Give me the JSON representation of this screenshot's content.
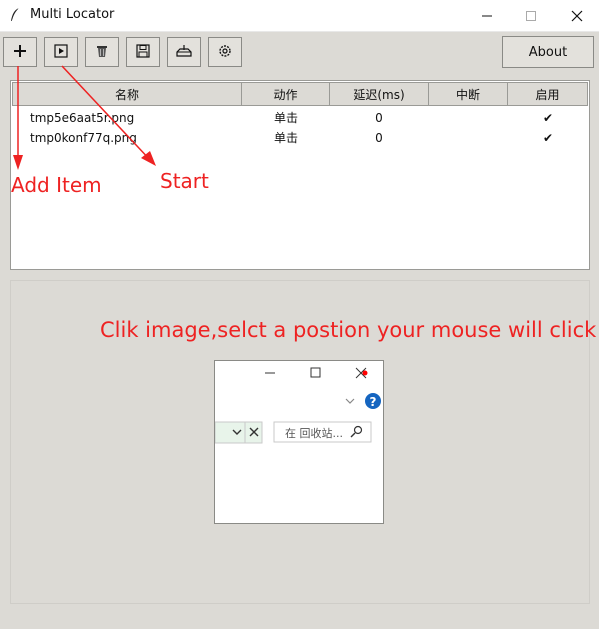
{
  "window": {
    "title": "Multi Locator",
    "icons": {
      "app": "feather-icon",
      "minimize": "minimize-icon",
      "maximize": "maximize-icon",
      "close": "close-icon"
    }
  },
  "toolbar": {
    "buttons": [
      {
        "name": "add-item",
        "icon": "plus-icon"
      },
      {
        "name": "start",
        "icon": "play-icon"
      },
      {
        "name": "delete",
        "icon": "trash-icon"
      },
      {
        "name": "save",
        "icon": "save-icon"
      },
      {
        "name": "load",
        "icon": "tray-icon"
      },
      {
        "name": "settings",
        "icon": "gear-icon"
      }
    ],
    "about_label": "About"
  },
  "table": {
    "columns": [
      "名称",
      "动作",
      "延迟(ms)",
      "中断",
      "启用"
    ],
    "rows": [
      {
        "name": "tmp5e6aat5r.png",
        "action": "单击",
        "delay": "0",
        "interrupt": "",
        "enabled": "✔"
      },
      {
        "name": "tmp0konf77q.png",
        "action": "单击",
        "delay": "0",
        "interrupt": "",
        "enabled": "✔"
      }
    ]
  },
  "annotations": {
    "add_item": "Add Item",
    "start": "Start",
    "hint": "Clik image,selct a postion your mouse will click",
    "color": "#ee2222"
  },
  "preview": {
    "search_placeholder": "在 回收站...",
    "icons": [
      "minimize-icon",
      "maximize-icon",
      "close-icon",
      "chevron-down-icon",
      "help-icon",
      "chevron-down-icon",
      "close-icon",
      "search-icon"
    ]
  }
}
